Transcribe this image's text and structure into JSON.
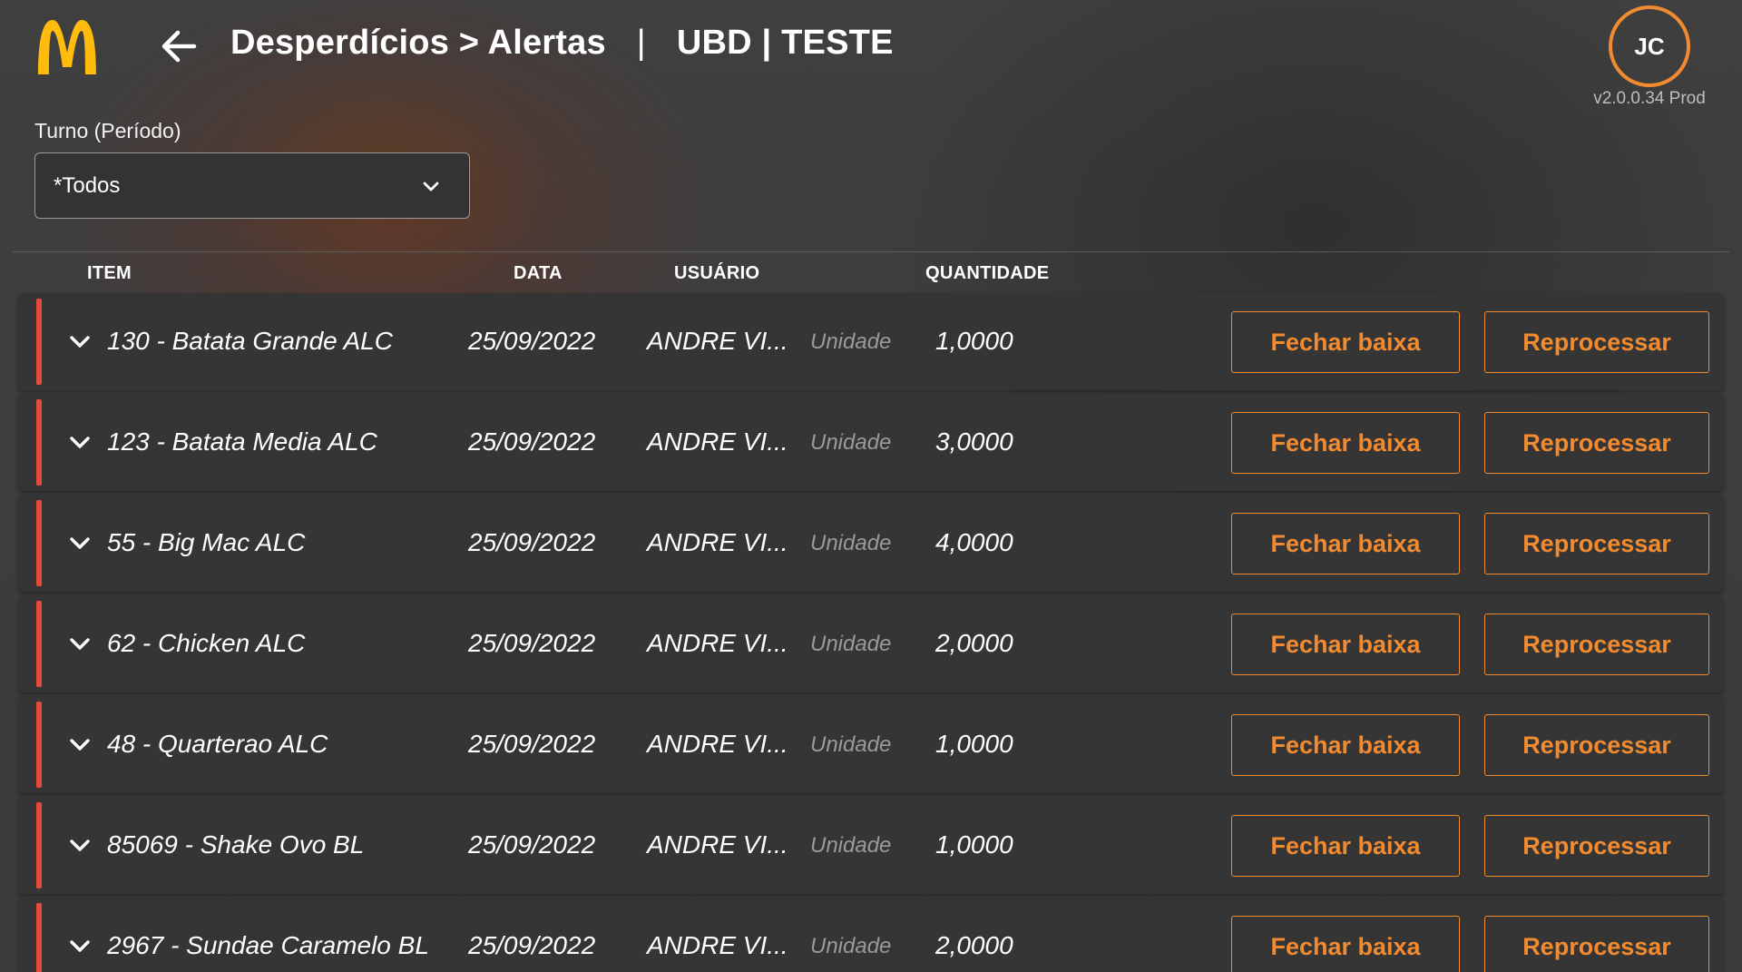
{
  "header": {
    "breadcrumb": "Desperdícios > Alertas",
    "separator": "|",
    "store": "UBD | TESTE",
    "avatar_initials": "JC",
    "version": "v2.0.0.34 Prod"
  },
  "filter": {
    "label": "Turno (Período)",
    "selected": "*Todos"
  },
  "table": {
    "columns": {
      "item": "ITEM",
      "date": "DATA",
      "user": "USUÁRIO",
      "quantity": "QUANTIDADE"
    },
    "rows": [
      {
        "item": "130 - Batata Grande ALC",
        "date": "25/09/2022",
        "user": "ANDRE VI...",
        "unit": "Unidade",
        "quantity": "1,0000",
        "close_label": "Fechar baixa",
        "reprocess_label": "Reprocessar"
      },
      {
        "item": "123 - Batata Media ALC",
        "date": "25/09/2022",
        "user": "ANDRE VI...",
        "unit": "Unidade",
        "quantity": "3,0000",
        "close_label": "Fechar baixa",
        "reprocess_label": "Reprocessar"
      },
      {
        "item": "55 - Big Mac ALC",
        "date": "25/09/2022",
        "user": "ANDRE VI...",
        "unit": "Unidade",
        "quantity": "4,0000",
        "close_label": "Fechar baixa",
        "reprocess_label": "Reprocessar"
      },
      {
        "item": "62 - Chicken ALC",
        "date": "25/09/2022",
        "user": "ANDRE VI...",
        "unit": "Unidade",
        "quantity": "2,0000",
        "close_label": "Fechar baixa",
        "reprocess_label": "Reprocessar"
      },
      {
        "item": "48 - Quarterao ALC",
        "date": "25/09/2022",
        "user": "ANDRE VI...",
        "unit": "Unidade",
        "quantity": "1,0000",
        "close_label": "Fechar baixa",
        "reprocess_label": "Reprocessar"
      },
      {
        "item": "85069 - Shake Ovo BL",
        "date": "25/09/2022",
        "user": "ANDRE VI...",
        "unit": "Unidade",
        "quantity": "1,0000",
        "close_label": "Fechar baixa",
        "reprocess_label": "Reprocessar"
      },
      {
        "item": "2967 - Sundae Caramelo BL",
        "date": "25/09/2022",
        "user": "ANDRE VI...",
        "unit": "Unidade",
        "quantity": "2,0000",
        "close_label": "Fechar baixa",
        "reprocess_label": "Reprocessar"
      }
    ]
  },
  "icons": {
    "logo": "golden-arches-logo",
    "back": "arrow-left-icon",
    "select": "chevron-down-icon",
    "expand": "chevron-down-icon"
  },
  "colors": {
    "accent": "#f28b30",
    "alert_marker": "#e64a3b",
    "logo": "#ffbc0d",
    "background": "#3d3d3d",
    "row_background": "#353535"
  }
}
